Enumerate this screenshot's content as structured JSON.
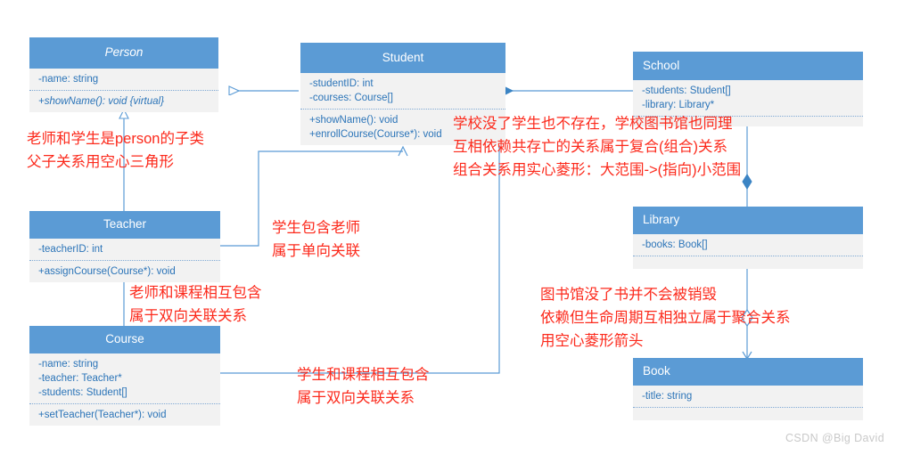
{
  "diagram": {
    "title": "UML Class Diagram",
    "accent_color": "#5b9bd5",
    "box_body_color": "#f2f2f2",
    "member_text_color": "#2b74b8",
    "annotation_color": "#fc2a1c"
  },
  "classes": {
    "person": {
      "name": "Person",
      "attributes": [
        "-name: string"
      ],
      "methods": [
        "+showName(): void {virtual}"
      ]
    },
    "student": {
      "name": "Student",
      "attributes": [
        "-studentID: int",
        "-courses: Course[]"
      ],
      "methods": [
        "+showName(): void",
        "+enrollCourse(Course*): void"
      ]
    },
    "school": {
      "name": "School",
      "attributes": [
        "-students: Student[]",
        "-library: Library*"
      ],
      "methods": []
    },
    "teacher": {
      "name": "Teacher",
      "attributes": [
        "-teacherID: int"
      ],
      "methods": [
        "+assignCourse(Course*): void"
      ]
    },
    "course": {
      "name": "Course",
      "attributes": [
        "-name: string",
        "-teacher: Teacher*",
        "-students: Student[]"
      ],
      "methods": [
        "+setTeacher(Teacher*): void"
      ]
    },
    "library": {
      "name": "Library",
      "attributes": [
        "-books: Book[]"
      ],
      "methods": []
    },
    "book": {
      "name": "Book",
      "attributes": [
        "-title: string"
      ],
      "methods": []
    }
  },
  "annotations": {
    "inheritance": {
      "line1": "老师和学生是person的子类",
      "line2": "父子关系用空心三角形"
    },
    "composition": {
      "line1": "学校没了学生也不存在，学校图书馆也同理",
      "line2": "互相依赖共存亡的关系属于复合(组合)关系",
      "line3": "组合关系用实心菱形：大范围->(指向)小范围"
    },
    "student_teacher": {
      "line1": "学生包含老师",
      "line2": "属于单向关联"
    },
    "teacher_course": {
      "line1": "老师和课程相互包含",
      "line2": "属于双向关联关系"
    },
    "student_course": {
      "line1": "学生和课程相互包含",
      "line2": "属于双向关联关系"
    },
    "aggregation": {
      "line1": "图书馆没了书并不会被销毁",
      "line2": "依赖但生命周期互相独立属于聚合关系",
      "line3": "用空心菱形箭头"
    }
  },
  "watermark": {
    "text": "CSDN @Big David"
  }
}
